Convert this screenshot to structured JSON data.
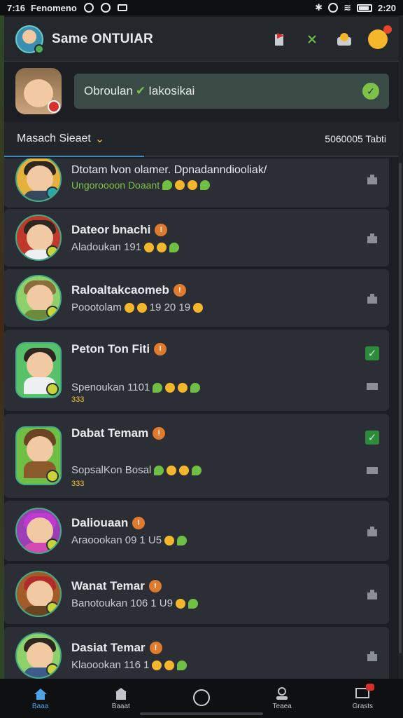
{
  "status_bar": {
    "time_left": "7:16",
    "carrier": "Fenomeno",
    "time_right": "2:20"
  },
  "app_bar": {
    "title": "Same ONTUIAR",
    "actions": [
      "flag-icon",
      "sparkle-icon",
      "profile-icon",
      "emoji-icon"
    ]
  },
  "chat_preview": {
    "text_prefix": "Obroulan",
    "check": "✔",
    "text_suffix": "Iakosikai"
  },
  "section": {
    "left_label": "Masach Sieaet",
    "right_label": "5060005 Tabti"
  },
  "contacts": [
    {
      "name": "Dtotam lvon olamer. Dpnadanndiooliak/",
      "status": "Ungoroooon Doaant",
      "extra": ""
    },
    {
      "name": "Dateor bnachi",
      "status": "Aladoukan 191",
      "extra": ""
    },
    {
      "name": "Raloaltakcaomeb",
      "status": "Poootolam",
      "extra": "19 20 19"
    },
    {
      "name": "Peton Ton Fiti",
      "status": "Spenoukan 1101",
      "extra": "333"
    },
    {
      "name": "Dabat Temam",
      "status": "SopsalKon Bosal",
      "extra": "333"
    },
    {
      "name": "Daliouaan",
      "status": "Araoookan 09",
      "extra": "1 U5"
    },
    {
      "name": "Wanat Temar",
      "status": "Banotoukan 106",
      "extra": "1 U9"
    },
    {
      "name": "Dasiat Temar",
      "status": "Klaoookan 116",
      "extra": "1"
    }
  ],
  "bottom_nav": [
    {
      "label": "Baaa",
      "icon": "home-icon"
    },
    {
      "label": "Baaat",
      "icon": "store-icon"
    },
    {
      "label": "",
      "icon": "circle-icon"
    },
    {
      "label": "Teaea",
      "icon": "person-icon"
    },
    {
      "label": "Grasts",
      "icon": "mail-icon"
    }
  ],
  "colors": {
    "background": "#1b1e22",
    "card": "#2b2f35",
    "accent_blue": "#4ea3e8",
    "accent_green": "#7cc24a",
    "pin_orange": "#e07a2c"
  }
}
